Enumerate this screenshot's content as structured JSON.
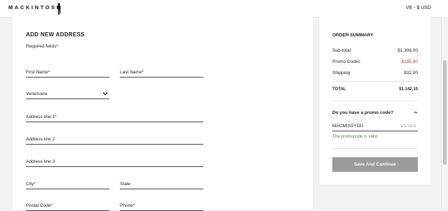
{
  "header": {
    "brand": "MACKINTOSH",
    "currency": "VE - $ USD"
  },
  "form": {
    "title": "ADD NEW ADDRESS",
    "required_note": "Required fields*",
    "fields": {
      "first_name": "First Name*",
      "last_name": "Last Name*",
      "country": "Venezuela",
      "address1": "Address line 1*",
      "address2": "Address line 2",
      "address3": "Address line 3",
      "city": "City*",
      "state": "State",
      "postal": "Postal Code*",
      "phone": "Phone*"
    }
  },
  "summary": {
    "title": "ORDER SUMMARY",
    "subtotal_label": "Sub-total",
    "subtotal_value": "$1.306,00",
    "promo_label": "Promo Codes",
    "promo_value": "-$195,90",
    "shipping_label": "Shipping",
    "shipping_value": "$32,00",
    "total_label": "TOTAL",
    "total_value": "$1.142,10",
    "promo_question": "Do you have a promo code?",
    "promo_code_value": "MACMISSYOU",
    "promo_enter": "ENTER",
    "promo_valid": "The promocode is valid",
    "save_button": "Save And Continue"
  }
}
